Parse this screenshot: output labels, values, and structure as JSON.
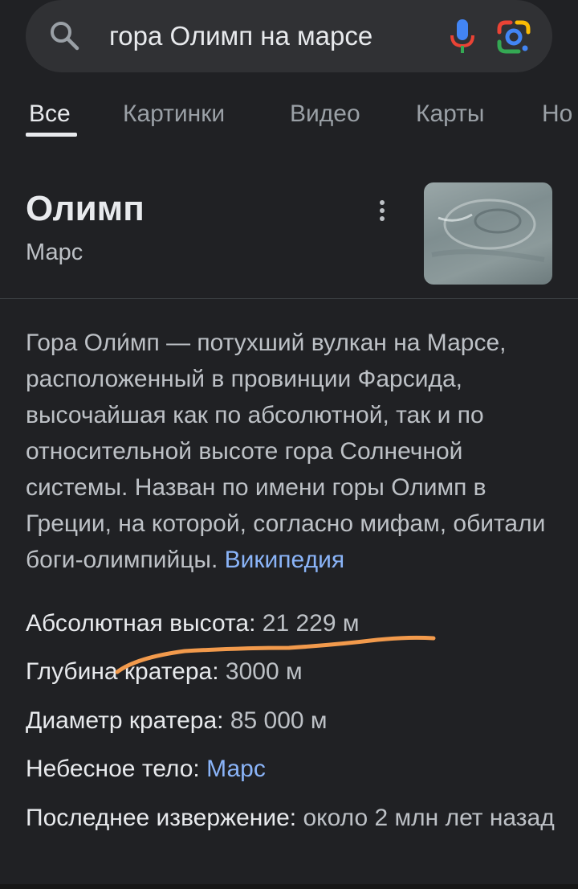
{
  "search": {
    "query": "гора Олимп на марсе",
    "icons": [
      "search-icon",
      "microphone-icon",
      "google-lens-icon"
    ]
  },
  "tabs": [
    {
      "label": "Все",
      "active": true
    },
    {
      "label": "Картинки",
      "active": false
    },
    {
      "label": "Видео",
      "active": false
    },
    {
      "label": "Карты",
      "active": false
    },
    {
      "label": "Но",
      "active": false
    }
  ],
  "knowledge_panel": {
    "title": "Олимп",
    "subtitle": "Марс",
    "description": "Гора Оли́мп — потухший вулкан на Марсе, расположенный в провинции Фарсида, высочайшая как по абсолютной, так и по относительной высоте гора Солнечной системы. Назван по имени горы Олимп в Греции, на которой, согласно мифам, обитали боги-олимпийцы.",
    "source_link": "Википедия",
    "facts": [
      {
        "label": "Абсолютная высота:",
        "value": "21 229 м",
        "link": false
      },
      {
        "label": "Глубина кратера:",
        "value": "3000 м",
        "link": false
      },
      {
        "label": "Диаметр кратера:",
        "value": "85 000 м",
        "link": false
      },
      {
        "label": "Небесное тело:",
        "value": "Марс",
        "link": true
      },
      {
        "label": "Последнее извержение:",
        "value": "около 2 млн лет назад",
        "link": false
      }
    ]
  },
  "colors": {
    "background": "#202124",
    "link": "#8ab4f8",
    "annotation": "#f29a4c"
  }
}
